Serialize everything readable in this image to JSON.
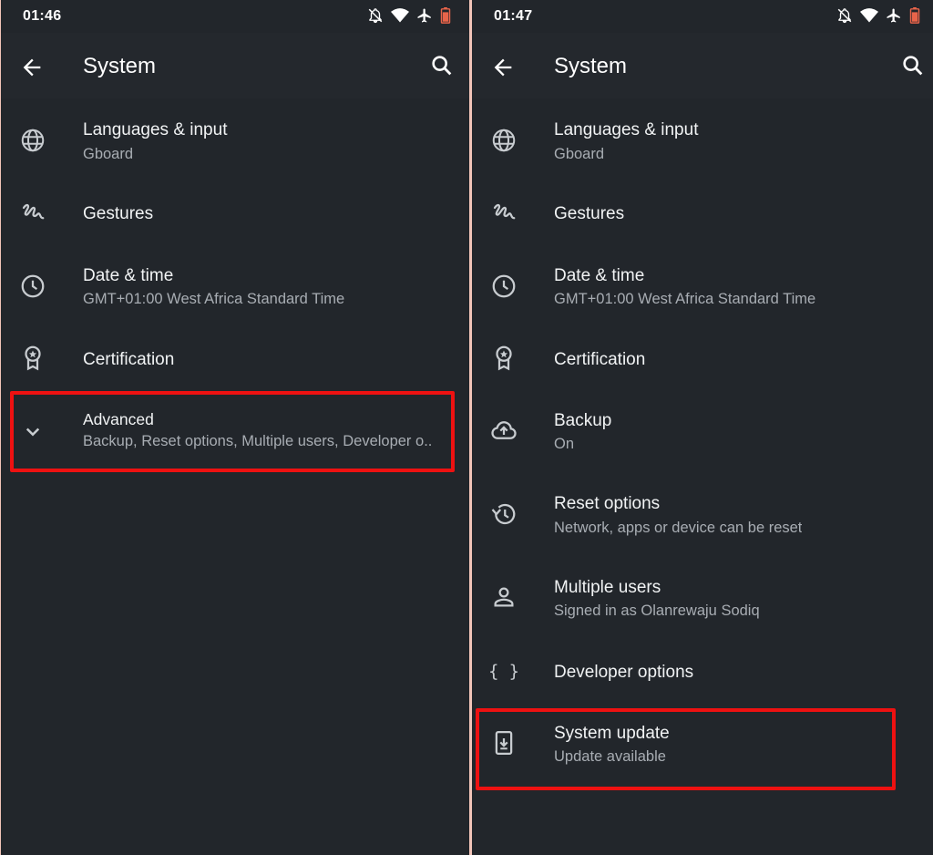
{
  "left": {
    "status_time": "01:46",
    "title": "System",
    "items": [
      {
        "primary": "Languages & input",
        "secondary": "Gboard"
      },
      {
        "primary": "Gestures",
        "secondary": ""
      },
      {
        "primary": "Date & time",
        "secondary": "GMT+01:00 West Africa Standard Time"
      },
      {
        "primary": "Certification",
        "secondary": ""
      },
      {
        "primary": "Advanced",
        "secondary": "Backup, Reset options, Multiple users, Developer o.."
      }
    ]
  },
  "right": {
    "status_time": "01:47",
    "title": "System",
    "items": [
      {
        "primary": "Languages & input",
        "secondary": "Gboard"
      },
      {
        "primary": "Gestures",
        "secondary": ""
      },
      {
        "primary": "Date & time",
        "secondary": "GMT+01:00 West Africa Standard Time"
      },
      {
        "primary": "Certification",
        "secondary": ""
      },
      {
        "primary": "Backup",
        "secondary": "On"
      },
      {
        "primary": "Reset options",
        "secondary": "Network, apps or device can be reset"
      },
      {
        "primary": "Multiple users",
        "secondary": "Signed in as Olanrewaju Sodiq"
      },
      {
        "primary": "Developer options",
        "secondary": ""
      },
      {
        "primary": "System update",
        "secondary": "Update available"
      }
    ]
  },
  "colors": {
    "background": "#22262b",
    "highlight": "#ee1111",
    "text": "#f1f3f4",
    "subtext": "#a8adb3"
  },
  "icons": [
    "back-arrow-icon",
    "search-icon",
    "globe-icon",
    "gesture-icon",
    "clock-icon",
    "certification-icon",
    "chevron-down-icon",
    "backup-icon",
    "restore-icon",
    "person-icon",
    "code-braces-icon",
    "system-update-icon"
  ]
}
